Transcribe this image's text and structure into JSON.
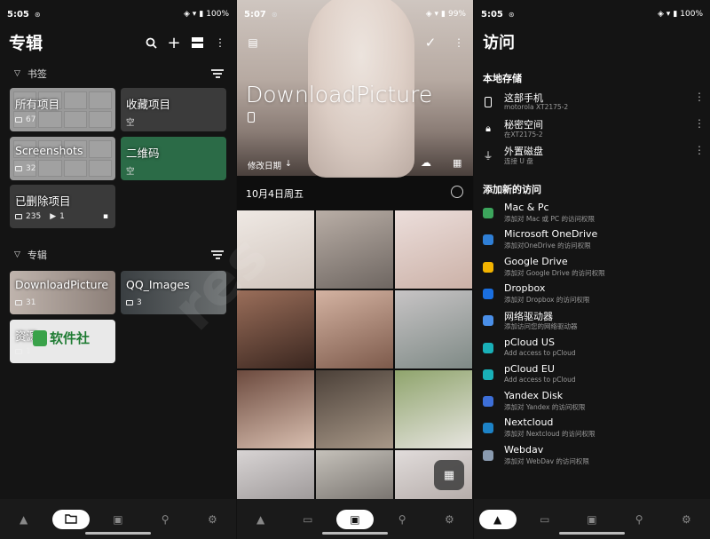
{
  "panel1": {
    "status": {
      "time": "5:05",
      "right": "100%"
    },
    "title": "专辑",
    "bookmark_section": "书签",
    "album_section": "专辑",
    "bookmarks": [
      {
        "label": "所有项目",
        "count": "67"
      },
      {
        "label": "收藏项目",
        "sub": "空"
      },
      {
        "label": "Screenshots",
        "count": "32"
      },
      {
        "label": "二维码",
        "sub": "空"
      },
      {
        "label": "已删除项目",
        "count": "235",
        "count2": "1"
      }
    ],
    "albums": [
      {
        "label": "DownloadPicture",
        "count": "31"
      },
      {
        "label": "QQ_Images",
        "count": "3"
      },
      {
        "label": "资源",
        "count": "1"
      }
    ],
    "watermark_logo": "软件社"
  },
  "panel2": {
    "status": {
      "time": "5:07",
      "right": "99%"
    },
    "hero_title": "DownloadPicture",
    "sort_label": "修改日期",
    "date_header": "10月4日周五"
  },
  "panel3": {
    "status": {
      "time": "5:05",
      "right": "100%"
    },
    "title": "访问",
    "local_section": "本地存储",
    "add_section": "添加新的访问",
    "local": [
      {
        "name": "这部手机",
        "sub": "motorola XT2175-2"
      },
      {
        "name": "秘密空间",
        "sub": "在XT2175-2"
      },
      {
        "name": "外置磁盘",
        "sub": "连接 U 盘"
      }
    ],
    "services": [
      {
        "name": "Mac & Pc",
        "sub": "添加对 Mac 或 PC 的访问权限",
        "color": "#3ca55c"
      },
      {
        "name": "Microsoft OneDrive",
        "sub": "添加对OneDrive 的访问权限",
        "color": "#2f7fd6"
      },
      {
        "name": "Google Drive",
        "sub": "添加对 Google Drive 的访问权限",
        "color": "#f2b300"
      },
      {
        "name": "Dropbox",
        "sub": "添加对 Dropbox 的访问权限",
        "color": "#1a6fe0"
      },
      {
        "name": "网络驱动器",
        "sub": "添加访问您的网络驱动器",
        "color": "#4a8fe8"
      },
      {
        "name": "pCloud US",
        "sub": "Add access to pCloud",
        "color": "#19b0b8"
      },
      {
        "name": "pCloud EU",
        "sub": "Add access to pCloud",
        "color": "#19b0b8"
      },
      {
        "name": "Yandex Disk",
        "sub": "添加对 Yandex 的访问权限",
        "color": "#3d6fd8"
      },
      {
        "name": "Nextcloud",
        "sub": "添加对 Nextcloud 的访问权限",
        "color": "#1d83c7"
      },
      {
        "name": "Webdav",
        "sub": "添加对 WebDav 的访问权限",
        "color": "#8a9bb0"
      }
    ]
  },
  "overlay_watermark": "res"
}
